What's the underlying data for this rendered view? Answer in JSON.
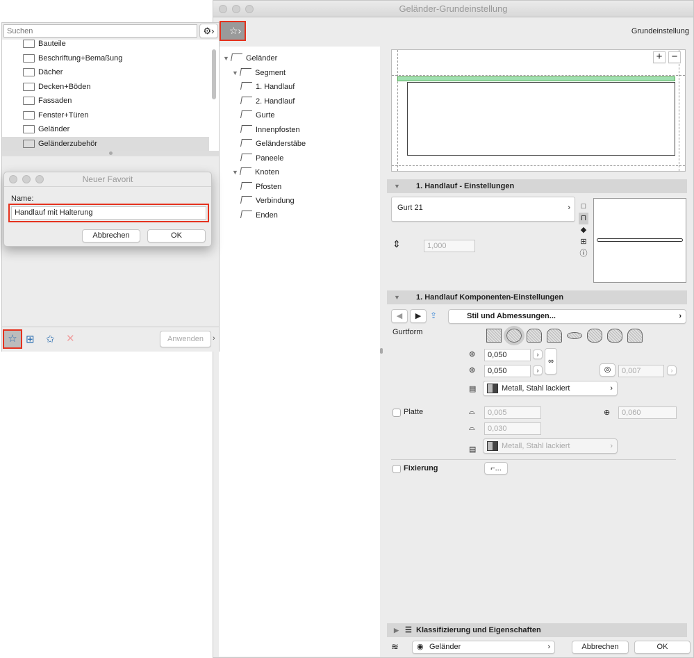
{
  "window": {
    "title": "Geländer-Grundeinstellung",
    "preset": "Grundeinstellung"
  },
  "tree": [
    {
      "label": "Geländer",
      "level": 0,
      "expanded": true
    },
    {
      "label": "Segment",
      "level": 1,
      "expanded": true
    },
    {
      "label": "1. Handlauf",
      "level": 2
    },
    {
      "label": "2. Handlauf",
      "level": 2
    },
    {
      "label": "Gurte",
      "level": 2
    },
    {
      "label": "Innenpfosten",
      "level": 2
    },
    {
      "label": "Geländerstäbe",
      "level": 2
    },
    {
      "label": "Paneele",
      "level": 2
    },
    {
      "label": "Knoten",
      "level": 1,
      "expanded": true
    },
    {
      "label": "Pfosten",
      "level": 2
    },
    {
      "label": "Verbindung",
      "level": 2
    },
    {
      "label": "Enden",
      "level": 2
    }
  ],
  "preview": {
    "zoom_in": "+",
    "zoom_out": "−"
  },
  "section1": {
    "title": "1. Handlauf - Einstellungen",
    "profile": "Gurt 21",
    "height": "1,000"
  },
  "section2": {
    "title": "1. Handlauf Komponenten-Einstellungen",
    "dropdown": "Stil und Abmessungen...",
    "gurtform_label": "Gurtform",
    "width": "0,050",
    "height": "0,050",
    "thickness": "0,007",
    "material": "Metall, Stahl lackiert",
    "platte_label": "Platte",
    "platte_thick": "0,005",
    "platte_width": "0,030",
    "platte_offset": "0,060",
    "platte_material": "Metall, Stahl lackiert",
    "fixierung_label": "Fixierung",
    "fixierung_btn": "..."
  },
  "section3": {
    "title": "Klassifizierung und Eigenschaften"
  },
  "footer": {
    "layer": "Geländer",
    "cancel": "Abbrechen",
    "ok": "OK"
  },
  "palette": {
    "search_placeholder": "Suchen",
    "folders": [
      "Bauteile",
      "Beschriftung+Bemaßung",
      "Dächer",
      "Decken+Böden",
      "Fassaden",
      "Fenster+Türen",
      "Geländer",
      "Geländerzubehör"
    ],
    "apply": "Anwenden"
  },
  "dialog": {
    "title": "Neuer Favorit",
    "name_label": "Name:",
    "name_value": "Handlauf mit Halterung",
    "cancel": "Abbrechen",
    "ok": "OK"
  },
  "colors": {
    "highlight": "#e5321e",
    "selection_bar": "#9fe0b0"
  }
}
